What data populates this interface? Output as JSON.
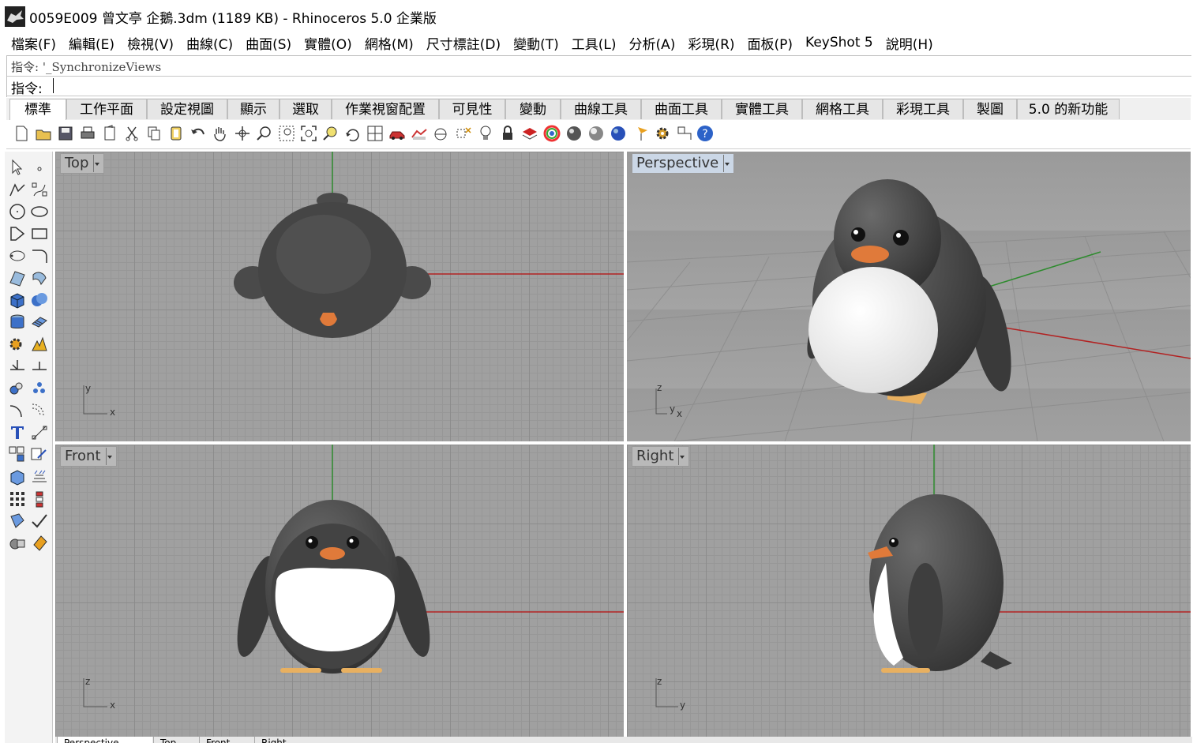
{
  "window": {
    "title": "0059E009 曾文亭 企鵝.3dm (1189 KB) - Rhinoceros  5.0 企業版",
    "app_icon": "rhino-icon"
  },
  "menu": {
    "items": [
      "檔案(F)",
      "編輯(E)",
      "檢視(V)",
      "曲線(C)",
      "曲面(S)",
      "實體(O)",
      "網格(M)",
      "尺寸標註(D)",
      "變動(T)",
      "工具(L)",
      "分析(A)",
      "彩現(R)",
      "面板(P)",
      "KeyShot 5",
      "說明(H)"
    ]
  },
  "command": {
    "history": "指令: '_SynchronizeViews",
    "prompt": "指令:",
    "value": ""
  },
  "tabs": {
    "items": [
      "標準",
      "工作平面",
      "設定視圖",
      "顯示",
      "選取",
      "作業視窗配置",
      "可見性",
      "變動",
      "曲線工具",
      "曲面工具",
      "實體工具",
      "網格工具",
      "彩現工具",
      "製圖",
      "5.0 的新功能"
    ],
    "active": "標準"
  },
  "toolbar": {
    "icons": [
      "new-file-icon",
      "open-file-icon",
      "save-icon",
      "print-icon",
      "paste-props-icon",
      "cut-icon",
      "copy-icon",
      "paste-icon",
      "undo-icon",
      "pan-hand-icon",
      "move-view-icon",
      "zoom-icon",
      "zoom-window-icon",
      "zoom-extents-icon",
      "zoom-selected-icon",
      "rotate-view-icon",
      "viewport-layout-icon",
      "car-icon",
      "named-view-icon",
      "construction-plane-icon",
      "toggle-icon",
      "light-icon",
      "lock-icon",
      "layer-icon",
      "color-wheel-icon",
      "render-sphere-icon",
      "shaded-sphere-icon",
      "blue-sphere-icon",
      "flag-icon",
      "settings-gear-icon",
      "select-icon",
      "help-icon"
    ]
  },
  "viewports": {
    "top": {
      "label": "Top",
      "axes": [
        "y",
        "x"
      ]
    },
    "perspective": {
      "label": "Perspective",
      "axes": [
        "z",
        "y",
        "x"
      ]
    },
    "front": {
      "label": "Front",
      "axes": [
        "z",
        "x"
      ]
    },
    "right": {
      "label": "Right",
      "axes": [
        "z",
        "y"
      ]
    }
  },
  "viewport_tabs": [
    "Perspective",
    "Top",
    "Front",
    "Right"
  ],
  "colors": {
    "grid_bg": "#a0a0a0",
    "x_axis": "#b22222",
    "y_axis": "#2e8b2e",
    "penguin_body": "#4a4a4a",
    "penguin_belly": "#ffffff",
    "beak": "#e07a3a",
    "feet": "#e8b060",
    "active_label": "#cbd7e6"
  }
}
